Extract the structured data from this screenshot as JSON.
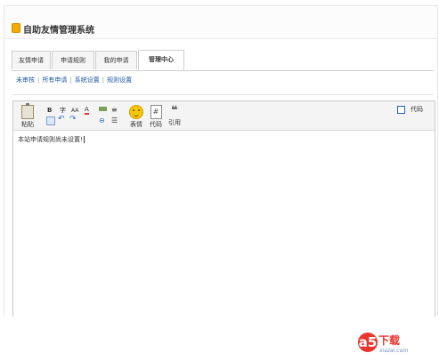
{
  "header": {
    "title": "自助友情管理系统",
    "icon": "coin-stack-icon",
    "accent": "#f5a800"
  },
  "tabs": [
    {
      "label": "友情申请",
      "active": false
    },
    {
      "label": "申请规则",
      "active": false
    },
    {
      "label": "我的申请",
      "active": false
    },
    {
      "label": "管理中心",
      "active": true
    }
  ],
  "subnav": {
    "items": [
      "未审核",
      "所有申请",
      "系统设置",
      "规则设置"
    ],
    "separator": "|",
    "link_color": "#1e5aa8"
  },
  "editor": {
    "toolbar": {
      "paste_label": "粘贴",
      "bold": "B",
      "strike": "字",
      "font_size": "AA",
      "font_color": "A",
      "emoji_label": "表情",
      "code_label": "代码",
      "code_glyph": "#",
      "quote_label": "引用",
      "quote_glyph": "❝"
    },
    "code_toggle_label": "代码",
    "code_toggle_checked": false,
    "content": "本站申请规则尚未设置!"
  },
  "watermark": {
    "logo": "a5",
    "text": "下载",
    "url": "xiazai.com"
  }
}
